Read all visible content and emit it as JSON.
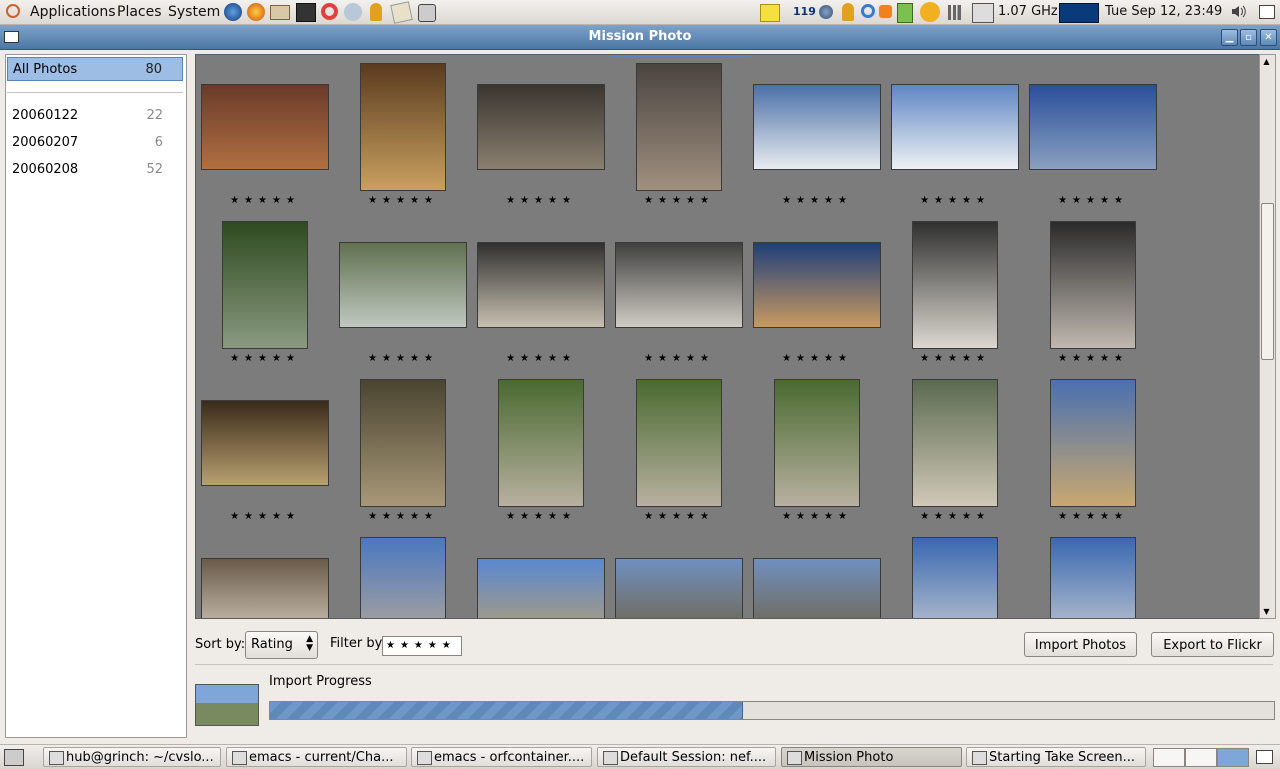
{
  "top_panel": {
    "menus": [
      "Applications",
      "Places",
      "System"
    ],
    "tray_number": "119",
    "cpu_freq": "1.07 GHz",
    "clock": "Tue Sep 12, 23:49"
  },
  "window": {
    "title": "Mission Photo"
  },
  "sidebar": {
    "all": {
      "label": "All Photos",
      "count": "80"
    },
    "rolls": [
      {
        "label": "20060122",
        "count": "22"
      },
      {
        "label": "20060207",
        "count": "6"
      },
      {
        "label": "20060208",
        "count": "52"
      }
    ]
  },
  "grid": {
    "star_rating": "★★★★★",
    "photos": [
      {
        "name": "parliament-night",
        "colors": [
          "#6a3a2a",
          "#b07040"
        ]
      },
      {
        "name": "hall-lamp",
        "colors": [
          "#5a3b1f",
          "#c9a060"
        ]
      },
      {
        "name": "terminal-ceiling",
        "colors": [
          "#3a3530",
          "#8a8070"
        ]
      },
      {
        "name": "terminal-corridor",
        "colors": [
          "#4a4440",
          "#a09080"
        ]
      },
      {
        "name": "snow-field-barn",
        "colors": [
          "#4b6fa8",
          "#e8ecf0"
        ]
      },
      {
        "name": "snow-field-tree",
        "colors": [
          "#5f86c4",
          "#eef1f4"
        ]
      },
      {
        "name": "glass-platform",
        "colors": [
          "#2a4f9a",
          "#8aa0c0"
        ]
      },
      {
        "name": "statue-garden",
        "colors": [
          "#2e4a20",
          "#8a9a80"
        ]
      },
      {
        "name": "pedestal-park",
        "colors": [
          "#607050",
          "#c0c8c0"
        ]
      },
      {
        "name": "fence-exhibit-1",
        "colors": [
          "#303030",
          "#c8c0b0"
        ]
      },
      {
        "name": "fence-exhibit-2",
        "colors": [
          "#404040",
          "#d0ccc4"
        ]
      },
      {
        "name": "paris-building",
        "colors": [
          "#1e3e7a",
          "#c89a60"
        ]
      },
      {
        "name": "fence-visitor",
        "colors": [
          "#303030",
          "#dcd8d0"
        ]
      },
      {
        "name": "fence-portrait",
        "colors": [
          "#2a2a2a",
          "#c0b8b0"
        ]
      },
      {
        "name": "dome-trees",
        "colors": [
          "#3a2a1a",
          "#b8a070"
        ]
      },
      {
        "name": "grotto-fountain",
        "colors": [
          "#4a4430",
          "#a89878"
        ]
      },
      {
        "name": "bronze-statue-1",
        "colors": [
          "#4a6a30",
          "#b8b0a0"
        ]
      },
      {
        "name": "bronze-statue-2",
        "colors": [
          "#4a6a30",
          "#b8b0a0"
        ]
      },
      {
        "name": "bronze-statue-3",
        "colors": [
          "#4a6a30",
          "#b8b0a0"
        ]
      },
      {
        "name": "palace-statue",
        "colors": [
          "#5a6a50",
          "#d0c8b8"
        ]
      },
      {
        "name": "palace-facade",
        "colors": [
          "#4a70b0",
          "#c8a870"
        ]
      },
      {
        "name": "balustrade-trees",
        "colors": [
          "#6a5a48",
          "#d8d0c4"
        ]
      },
      {
        "name": "palace-dome",
        "colors": [
          "#4a78c0",
          "#c8b090"
        ]
      },
      {
        "name": "palace-wide",
        "colors": [
          "#5a88d0",
          "#b8a070"
        ]
      },
      {
        "name": "garden-obelisk-1",
        "colors": [
          "#7090c0",
          "#706040"
        ]
      },
      {
        "name": "garden-obelisk-2",
        "colors": [
          "#7090c0",
          "#706040"
        ]
      },
      {
        "name": "marble-statue-1",
        "colors": [
          "#3a68b0",
          "#e0ddd8"
        ]
      },
      {
        "name": "marble-statue-2",
        "colors": [
          "#3a68b0",
          "#e0ddd8"
        ]
      }
    ]
  },
  "controls": {
    "sort_label": "Sort by:",
    "sort_value": "Rating",
    "filter_label": "Filter by:",
    "filter_value": "★★★★★",
    "import_button": "Import Photos",
    "export_button": "Export to Flickr",
    "progress_label": "Import Progress",
    "progress_fraction": 0.47
  },
  "taskbar": {
    "tasks": [
      "hub@grinch: ~/cvslo...",
      "emacs - current/Cha...",
      "emacs - orfcontainer....",
      "Default Session: nef....",
      "Mission Photo",
      "Starting Take Screen..."
    ]
  }
}
